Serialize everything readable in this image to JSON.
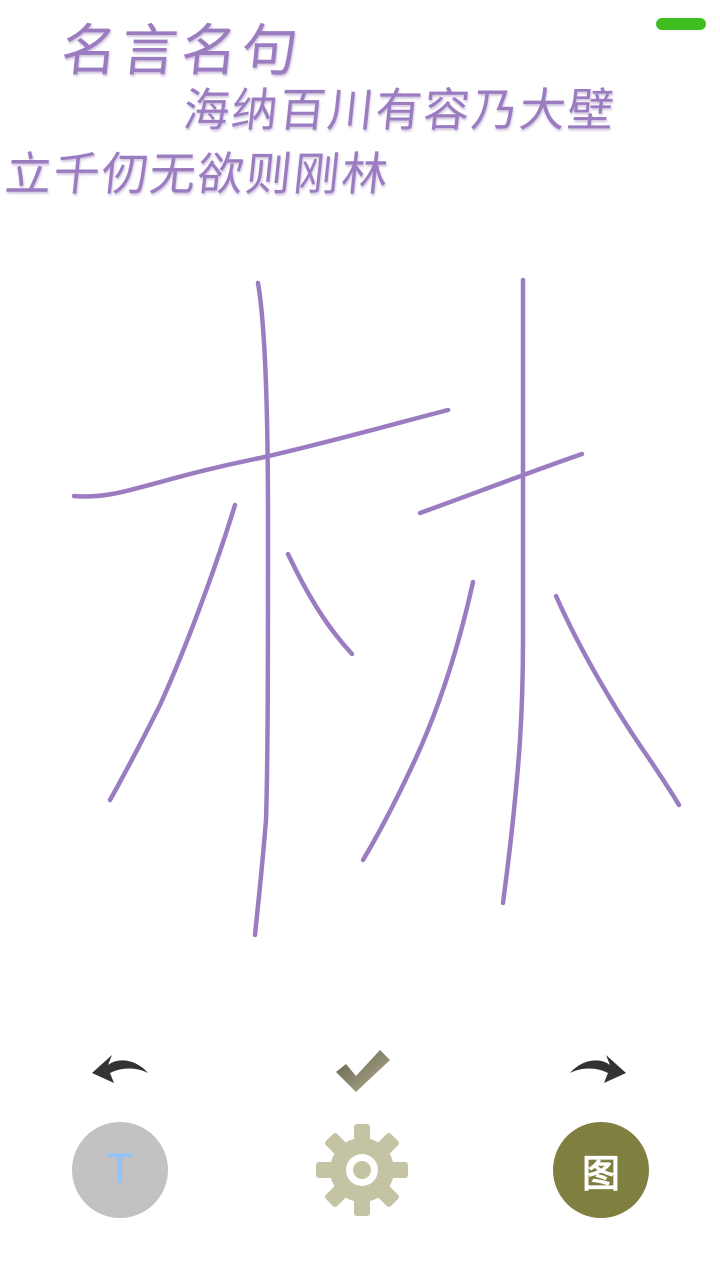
{
  "header": {
    "title": "名言名句",
    "quote_line1": "海纳百川有容乃大壁",
    "quote_line2": "立千仞无欲则刚林"
  },
  "canvas": {
    "drawn_character": "林",
    "stroke_color": "#9b7cc0"
  },
  "toolbar": {
    "undo_icon": "undo-arrow-icon",
    "confirm_icon": "checkmark-icon",
    "redo_icon": "redo-arrow-icon"
  },
  "bottom_bar": {
    "text_button_label": "T",
    "settings_icon": "gear-icon",
    "image_button_label": "图"
  },
  "colors": {
    "status_indicator": "#3fbf1f",
    "text_button_bg": "#c2c2c2",
    "text_button_fg": "#8fc4ff",
    "settings_gear": "#c4c4a4",
    "image_button_bg": "#7f7f3f",
    "icon_dark": "#333333"
  }
}
